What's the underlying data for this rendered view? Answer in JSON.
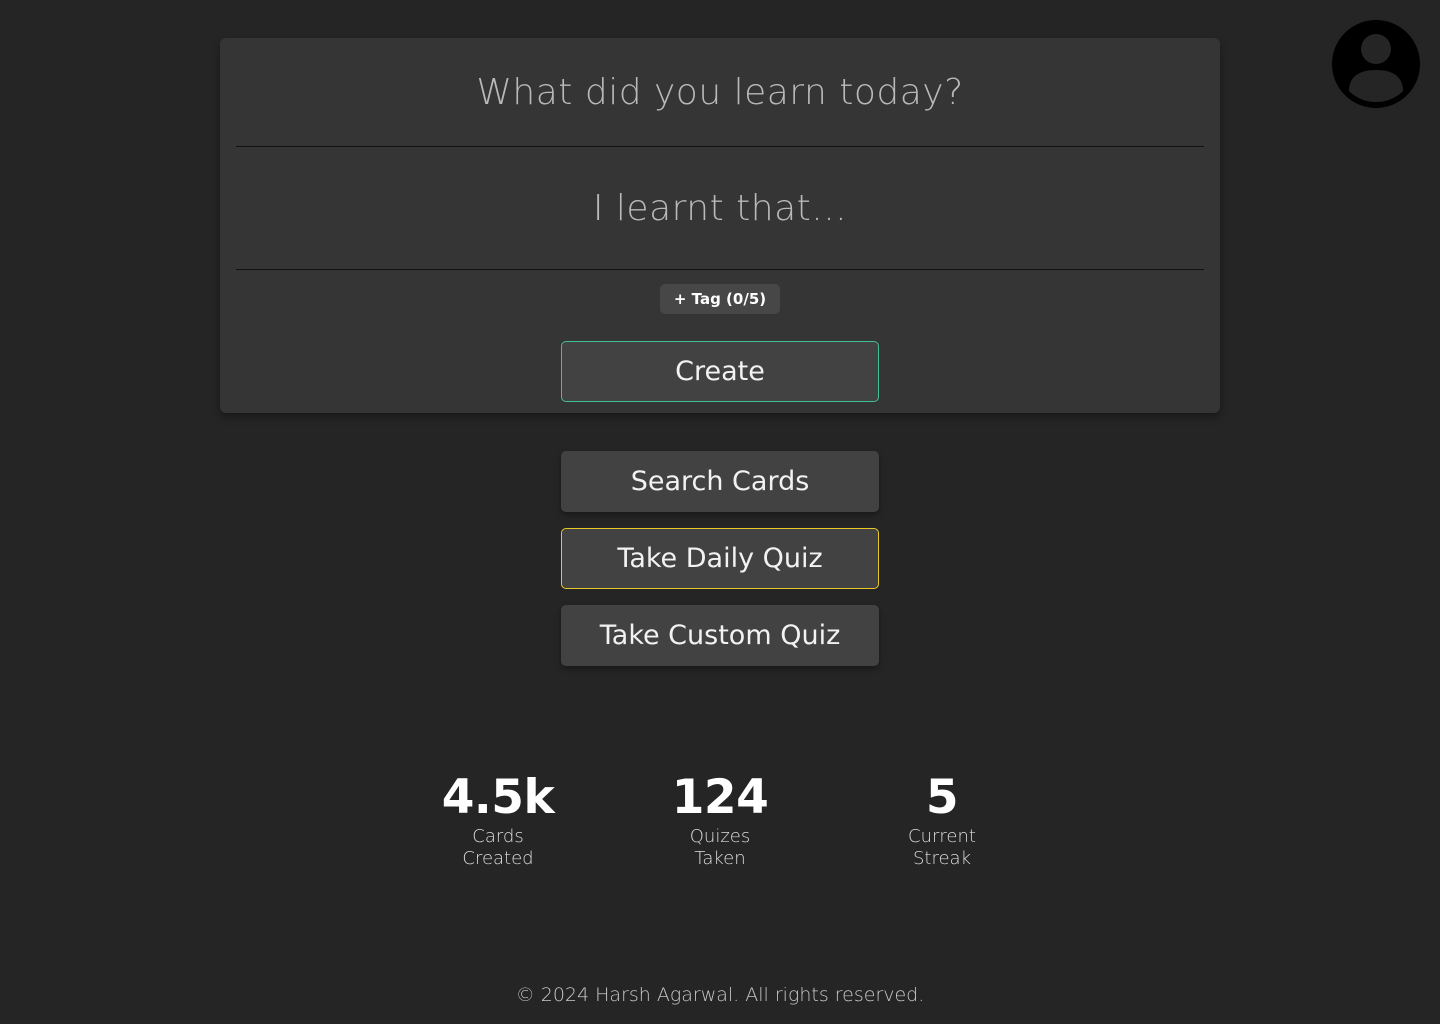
{
  "header": {
    "avatar_icon": "user-avatar-icon"
  },
  "composer": {
    "title_placeholder": "What did you learn today?",
    "body_placeholder": "I learnt that...",
    "tag_label": "+ Tag (0/5)",
    "create_label": "Create",
    "create_border_color": "#3fbf95"
  },
  "actions": {
    "search_label": "Search Cards",
    "daily_quiz_label": "Take Daily Quiz",
    "daily_quiz_border_color": "#e8c828",
    "custom_quiz_label": "Take Custom Quiz"
  },
  "stats": [
    {
      "value": "4.5k",
      "label": "Cards Created"
    },
    {
      "value": "124",
      "label": "Quizes Taken"
    },
    {
      "value": "5",
      "label": "Current Streak"
    }
  ],
  "footer": {
    "text": "© 2024 Harsh Agarwal. All rights reserved."
  }
}
